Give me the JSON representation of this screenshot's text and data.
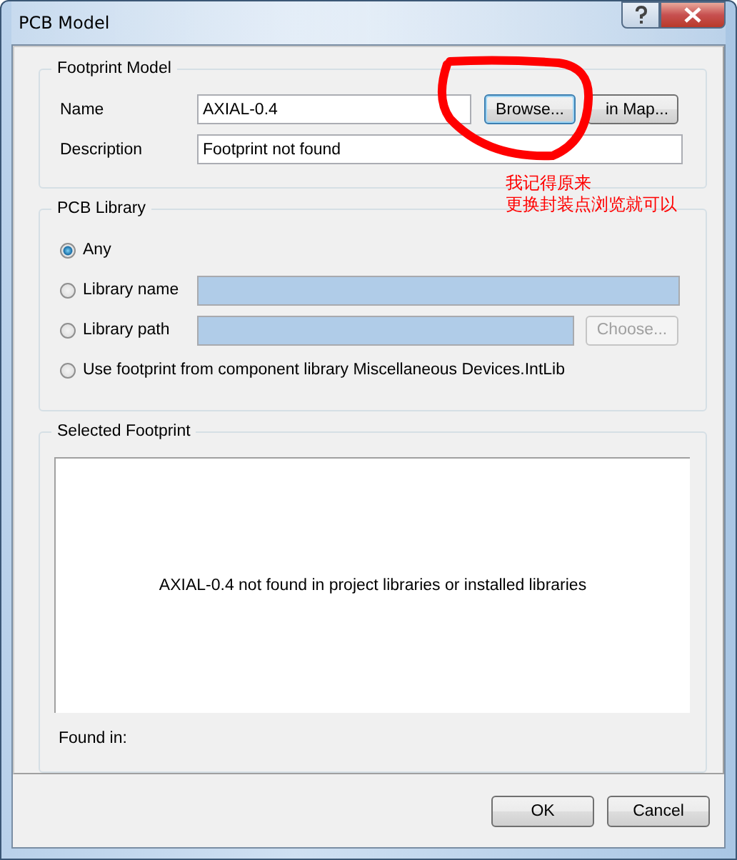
{
  "window": {
    "title": "PCB Model"
  },
  "footprint_model": {
    "title": "Footprint Model",
    "name": {
      "label": "Name",
      "value": "AXIAL-0.4"
    },
    "browse_button": {
      "label": "Browse...",
      "focused": true
    },
    "pin_map_button": {
      "label": "in Map..."
    },
    "description": {
      "label": "Description",
      "value": "Footprint not found"
    }
  },
  "annotation": {
    "color": "#ff0000",
    "lines": [
      "我记得原来",
      "更换封装点浏览就可以"
    ]
  },
  "pcb_library": {
    "title": "PCB Library",
    "options": [
      {
        "kind": "plain",
        "label": "Any",
        "selected": true
      },
      {
        "kind": "field",
        "label": "Library name",
        "selected": false
      },
      {
        "kind": "field-button",
        "label": "Library path",
        "selected": false,
        "button": {
          "label": "Choose...",
          "disabled": true
        }
      },
      {
        "kind": "plain",
        "label": "Use footprint from component library Miscellaneous Devices.IntLib",
        "selected": false
      }
    ]
  },
  "selected_footprint": {
    "title": "Selected Footprint",
    "message": "AXIAL-0.4 not found in project libraries or installed libraries",
    "found_in_label": "Found in:"
  },
  "buttons": [
    {
      "label": "OK"
    },
    {
      "label": "Cancel"
    }
  ]
}
